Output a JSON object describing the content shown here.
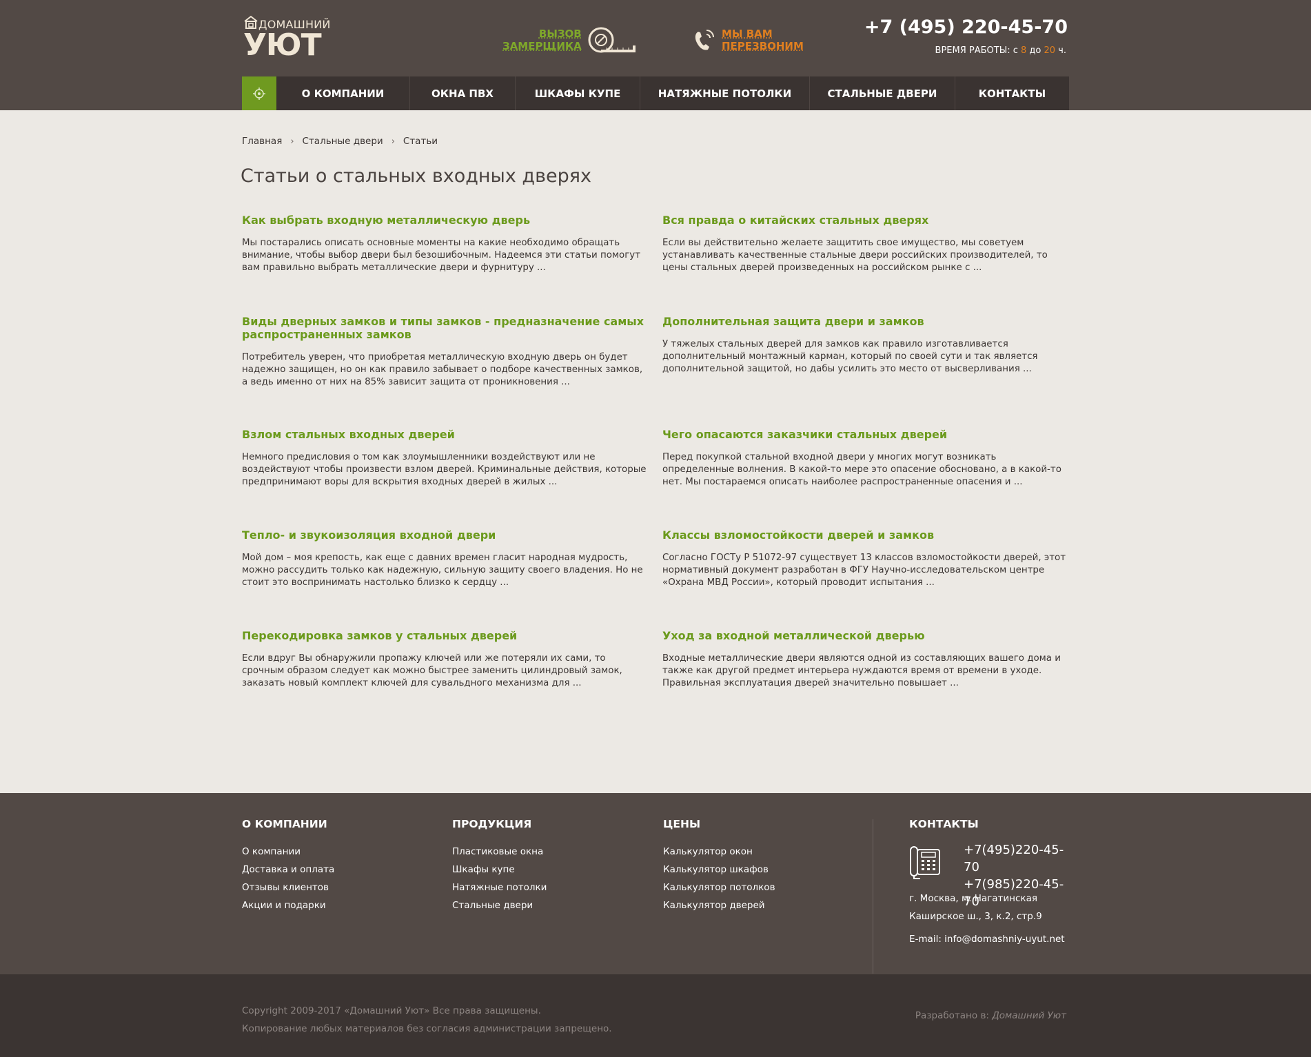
{
  "header": {
    "logo_small": "ДОМАШНИЙ",
    "logo_big": "УЮТ",
    "measure_line1": "ВЫЗОВ",
    "measure_line2": "ЗАМЕРЩИКА",
    "recall_line1": "МЫ ВАМ",
    "recall_line2": "ПЕРЕЗВОНИМ",
    "phone": "+7 (495) 220-45-70",
    "hours_prefix": "ВРЕМЯ РАБОТЫ: с ",
    "hours_from": "8",
    "hours_mid": " до ",
    "hours_to": "20",
    "hours_suffix": " ч."
  },
  "nav": {
    "items": [
      "О КОМПАНИИ",
      "ОКНА ПВХ",
      "ШКАФЫ КУПЕ",
      "НАТЯЖНЫЕ ПОТОЛКИ",
      "СТАЛЬНЫЕ ДВЕРИ",
      "КОНТАКТЫ"
    ]
  },
  "breadcrumb": [
    "Главная",
    "Стальные двери",
    "Статьи"
  ],
  "page_title": "Статьи о стальных входных дверях",
  "articles": [
    {
      "title": "Как выбрать входную металлическую дверь",
      "text": "Мы постарались описать основные моменты на какие необходимо обращать внимание, чтобы выбор двери был безошибочным. Надеемся эти статьи помогут вам правильно выбрать металлические двери и фурнитуру ..."
    },
    {
      "title": "Вся правда о китайских стальных дверях",
      "text": "Если вы действительно желаете защитить свое имущество, мы советуем устанавливать качественные стальные двери российских производителей, то цены стальных дверей произведенных на российском рынке с ..."
    },
    {
      "title": "Виды дверных замков и типы замков - предназначение самых распространенных замков",
      "text": "Потребитель уверен, что приобретая металлическую входную дверь он будет надежно защищен, но он как правило забывает о подборе качественных замков, а ведь именно от них на 85% зависит защита от проникновения ..."
    },
    {
      "title": "Дополнительная защита двери и замков",
      "text": "У тяжелых стальных дверей для замков как правило изготавливается дополнительный монтажный карман, который по своей сути и так является дополнительной защитой, но дабы усилить это место от высверливания ..."
    },
    {
      "title": "Взлом стальных входных дверей",
      "text": "Немного предисловия о том как злоумышленники воздействуют или не воздействуют чтобы произвести взлом дверей. Криминальные действия, которые предпринимают воры для вскрытия входных дверей в жилых ..."
    },
    {
      "title": "Чего опасаются заказчики стальных дверей",
      "text": "Перед покупкой стальной входной двери у многих могут возникать определенные волнения. В какой-то мере это опасение обосновано, а в какой-то нет. Мы постараемся описать наиболее распространенные опасения и ..."
    },
    {
      "title": "Тепло- и звукоизоляция входной двери",
      "text": "Мой дом – моя крепость, как еще с давних времен гласит народная мудрость, можно рассудить только как надежную, сильную защиту своего владения. Но не стоит это воспринимать настолько близко к сердцу ..."
    },
    {
      "title": "Классы взломостойкости дверей и замков",
      "text": "Согласно ГОСТу Р 51072-97 существует 13 классов взломостойкости дверей, этот нормативный документ разработан в ФГУ Научно-исследовательском центре «Охрана МВД России», который проводит испытания ..."
    },
    {
      "title": "Перекодировка замков у стальных дверей",
      "text": "Если вдруг Вы обнаружили пропажу ключей или же потеряли их сами, то срочным образом следует как можно быстрее заменить цилиндровый замок, заказать новый комплект ключей для сувальдного механизма для ..."
    },
    {
      "title": "Уход за входной металлической дверью",
      "text": "Входные металлические двери являются одной из составляющих вашего дома и также как другой предмет интерьера нуждаются время от времени в уходе. Правильная эксплуатация дверей значительно повышает ..."
    }
  ],
  "footer": {
    "col1": {
      "heading": "О КОМПАНИИ",
      "links": [
        "О компании",
        "Доставка и оплата",
        "Отзывы клиентов",
        "Акции и подарки"
      ]
    },
    "col2": {
      "heading": "ПРОДУКЦИЯ",
      "links": [
        "Пластиковые окна",
        "Шкафы купе",
        "Натяжные потолки",
        "Стальные двери"
      ]
    },
    "col3": {
      "heading": "ЦЕНЫ",
      "links": [
        "Калькулятор окон",
        "Калькулятор шкафов",
        "Калькулятор потолков",
        "Калькулятор дверей"
      ]
    },
    "contacts": {
      "heading": "КОНТАКТЫ",
      "phone1": "+7(495)220-45-70",
      "phone2": "+7(985)220-45-70",
      "addr1": "г. Москва, м. Нагатинская",
      "addr2": "Каширское ш., 3, к.2, стр.9",
      "email": "E-mail: info@domashniy-uyut.net"
    }
  },
  "bottom": {
    "copyright": "Copyright 2009-2017 «Домашний Уют» Все права защищены.",
    "notice": "Копирование любых материалов без согласия администрации запрещено.",
    "dev_prefix": "Разработано в: ",
    "dev_name": "Домашний Уют"
  },
  "colors": {
    "header_bg": "#524945",
    "nav_bg": "#3a3331",
    "accent_green": "#6b9a1c",
    "accent_orange": "#e07f1f",
    "page_bg": "#ece9e4"
  }
}
